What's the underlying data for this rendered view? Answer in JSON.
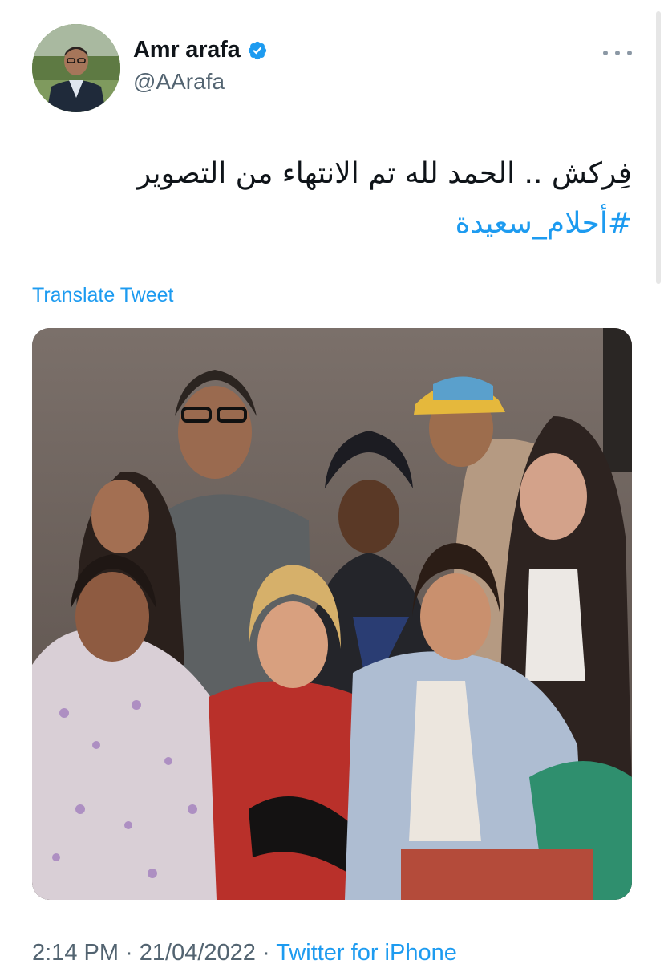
{
  "author": {
    "display_name": "Amr arafa",
    "handle": "@AArafa",
    "verified": true
  },
  "tweet": {
    "text": "فِركش .. الحمد لله تم الانتهاء من التصوير",
    "hashtag": "#أحلام_سعيدة",
    "translate_label": "Translate Tweet"
  },
  "footer": {
    "time": "2:14 PM",
    "separator": " · ",
    "date": "21/04/2022",
    "source": "Twitter for iPhone"
  },
  "colors": {
    "link": "#1d9bf0",
    "secondary_text": "#536471",
    "verified_badge": "#1d9bf0"
  },
  "icons": {
    "verified": "verified-badge-icon",
    "more": "more-horizontal-icon"
  }
}
